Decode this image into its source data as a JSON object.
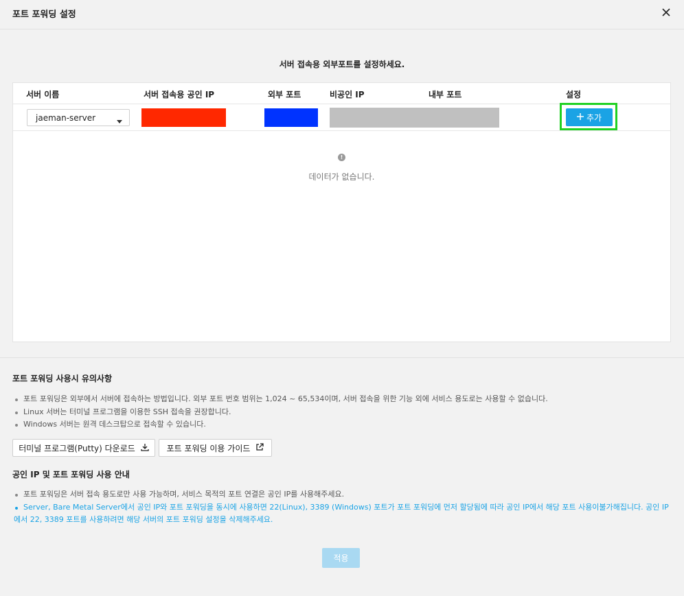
{
  "dialog": {
    "title": "포트 포워딩 설정",
    "close_icon": "close-icon"
  },
  "subtitle": "서버 접속용 외부포트를 설정하세요.",
  "table": {
    "headers": {
      "server_name": "서버 이름",
      "public_ip": "서버 접속용 공인 IP",
      "external_port": "외부 포트",
      "private_ip": "비공인 IP",
      "internal_port": "내부 포트",
      "settings": "설정"
    },
    "row": {
      "server_select_value": "jaeman-server",
      "add_label": "추가"
    },
    "empty_text": "데이터가 없습니다.",
    "empty_icon": "!"
  },
  "notes": {
    "title": "포트 포워딩 사용시 유의사항",
    "items": [
      "포트 포워딩은 외부에서 서버에 접속하는 방법입니다. 외부 포트 번호 범위는 1,024 ~ 65,534이며, 서버 접속을 위한 기능 외에 서비스 용도로는 사용할 수 없습니다.",
      "Linux 서버는 터미널 프로그램을 이용한 SSH 접속을 권장합니다.",
      "Windows 서버는 원격 데스크탑으로 접속할 수 있습니다."
    ],
    "putty_button": "터미널 프로그램(Putty) 다운로드",
    "guide_button": "포트 포워딩 이용 가이드"
  },
  "guide": {
    "title": "공인 IP 및 포트 포워딩 사용 안내",
    "items": [
      "포트 포워딩은 서버 접속 용도로만 사용 가능하며, 서비스 목적의 포트 연결은 공인 IP를 사용해주세요.",
      "Server, Bare Metal Server에서 공인 IP와 포트 포워딩을 동시에 사용하면 22(Linux), 3389 (Windows) 포트가 포트 포워딩에 먼저 할당됨에 따라 공인 IP에서 해당 포트 사용이불가해집니다. 공인 IP에서 22, 3389 포트를 사용하려면 해당 서버의 포트 포워딩 설정을 삭제해주세요."
    ]
  },
  "apply_label": "적용",
  "colors": {
    "accent": "#1aa3e5",
    "apply_disabled": "#a9d9f2",
    "highlight": "#1fd122",
    "redacted_public_ip": "#ff2800",
    "redacted_external_port": "#0033ff",
    "redacted_private_ip": "#c0c0c0"
  }
}
